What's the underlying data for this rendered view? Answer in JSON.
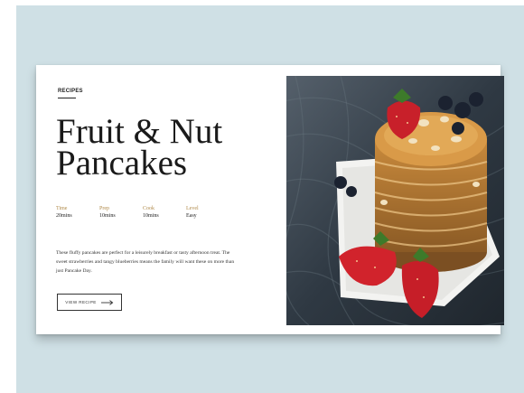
{
  "card": {
    "eyebrow": "RECIPES",
    "title_line1": "Fruit & Nut",
    "title_line2": "Pancakes",
    "meta": [
      {
        "label": "Time",
        "value": "20mins"
      },
      {
        "label": "Prep",
        "value": "10mins"
      },
      {
        "label": "Cook",
        "value": "10mins"
      },
      {
        "label": "Level",
        "value": "Easy"
      }
    ],
    "description": "These fluffy pancakes are perfect for a leisurely breakfast or tasty afternoon treat. The sweet strawberries and tangy blueberries means the family will want these on more than just Pancake Day.",
    "button_label": "VIEW RECIPE"
  },
  "image": {
    "subject": "pancakes-photo"
  },
  "colors": {
    "backdrop": "#cfe0e5",
    "accent": "#b08a4a",
    "text": "#1a1a1a"
  }
}
